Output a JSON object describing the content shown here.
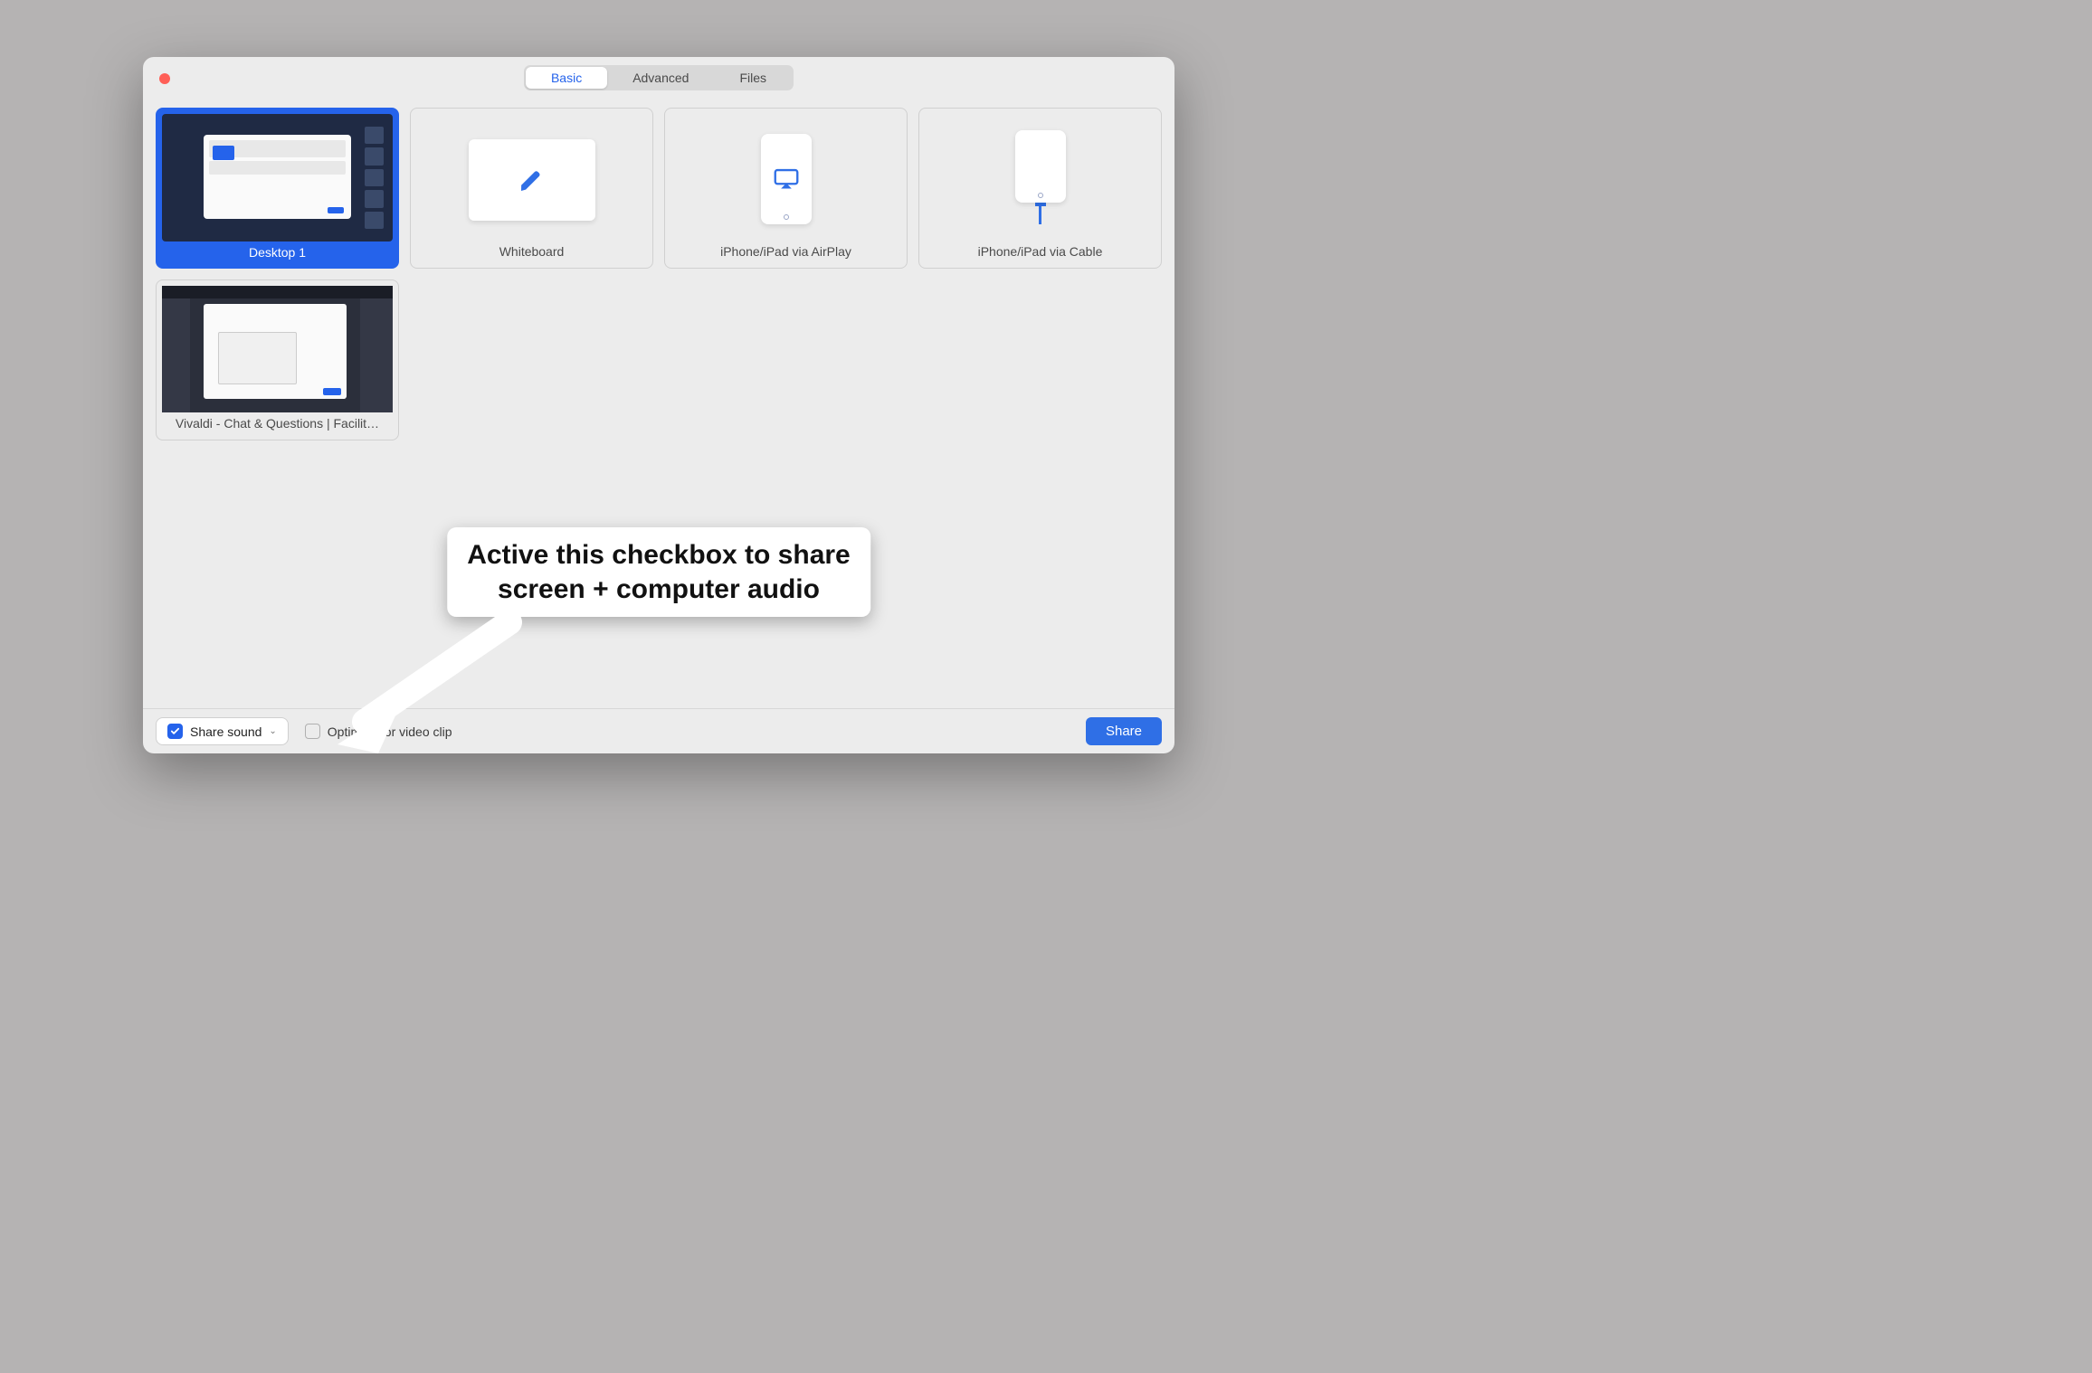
{
  "tabs": {
    "basic": "Basic",
    "advanced": "Advanced",
    "files": "Files",
    "active": "basic"
  },
  "sources": {
    "desktop1": "Desktop 1",
    "whiteboard": "Whiteboard",
    "airplay": "iPhone/iPad via AirPlay",
    "cable": "iPhone/iPad via Cable",
    "browser_window": "Vivaldi - Chat & Questions | Facilit…"
  },
  "footer": {
    "share_sound_label": "Share sound",
    "share_sound_checked": true,
    "optimize_label": "Optimize for video clip",
    "optimize_checked": false,
    "share_button": "Share"
  },
  "annotation": {
    "line1": "Active this checkbox to share",
    "line2": "screen + computer audio"
  }
}
